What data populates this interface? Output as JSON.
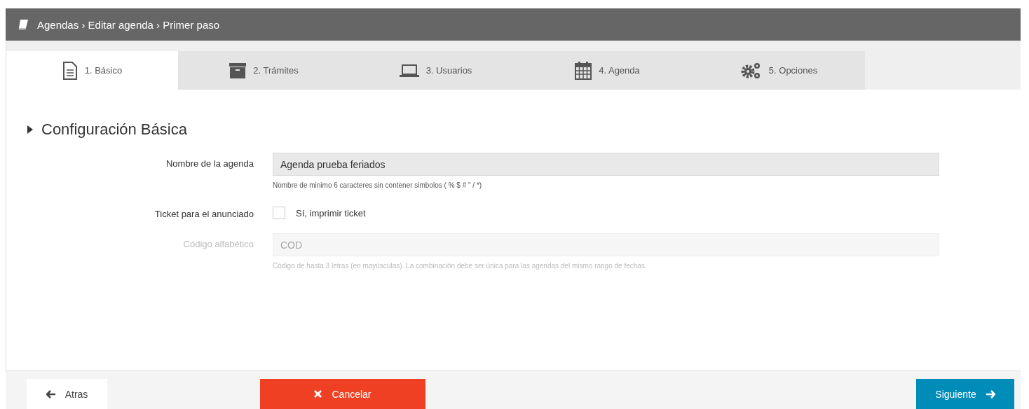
{
  "header": {
    "breadcrumb": "Agendas › Editar agenda › Primer paso"
  },
  "tabs": [
    {
      "label": "1. Básico",
      "kind": "document",
      "selected": true
    },
    {
      "label": "2. Trámites",
      "kind": "archive",
      "selected": false
    },
    {
      "label": "3. Usuarios",
      "kind": "laptop",
      "selected": false
    },
    {
      "label": "4. Agenda",
      "kind": "calendar",
      "selected": false
    },
    {
      "label": "5. Opciones",
      "kind": "gears",
      "selected": false
    }
  ],
  "section": {
    "title": "Configuración Básica"
  },
  "fields": [
    {
      "kind": "text",
      "label": "Nombre de la agenda",
      "value": "Agenda prueba feriados",
      "help": "Nombre de minimo 6 caracteres sin contener simbolos ( % $ # \" / *)",
      "disabled": false
    },
    {
      "kind": "checkbox",
      "label": "Ticket para el anunciado",
      "option": "Sí, imprimir ticket",
      "checked": false,
      "disabled": false
    },
    {
      "kind": "text",
      "label": "Código alfabético",
      "placeholder": "COD",
      "help": "Código de hasta 3 letras (en mayúsculas). La combinación debe ser única para las agendas del mismo rango de fechas.",
      "disabled": true
    }
  ],
  "footer": {
    "back": "Atras",
    "cancel": "Cancelar",
    "next": "Siguiente"
  }
}
